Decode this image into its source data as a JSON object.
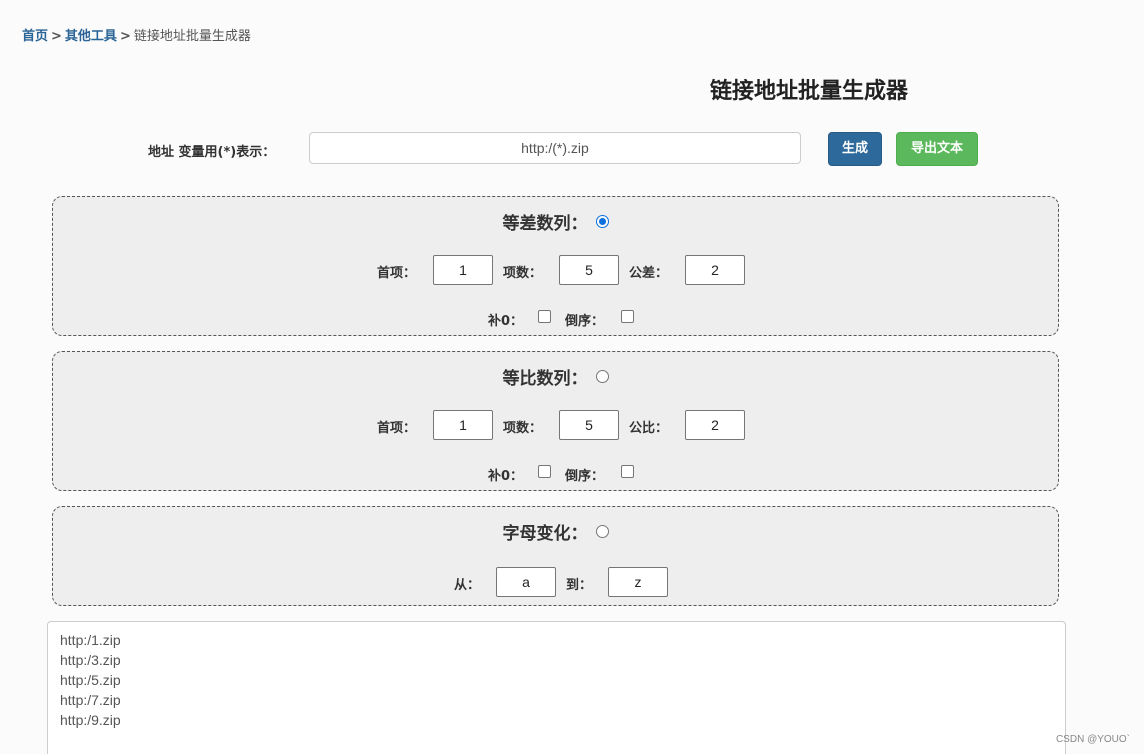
{
  "breadcrumb": {
    "home": "首页",
    "sep1": ">",
    "tools": "其他工具",
    "sep2": ">",
    "current": "链接地址批量生成器"
  },
  "title": "链接地址批量生成器",
  "address": {
    "label": "地址 变量用(*)表示：",
    "value": "http:/(*).zip"
  },
  "buttons": {
    "generate": "生成",
    "export": "导出文本"
  },
  "arithmetic": {
    "heading": "等差数列：",
    "selected": true,
    "first_label": "首项：",
    "first_value": "1",
    "count_label": "项数：",
    "count_value": "5",
    "diff_label": "公差：",
    "diff_value": "2",
    "pad_label": "补0：",
    "pad_checked": false,
    "reverse_label": "倒序：",
    "reverse_checked": false
  },
  "geometric": {
    "heading": "等比数列：",
    "selected": false,
    "first_label": "首项：",
    "first_value": "1",
    "count_label": "项数：",
    "count_value": "5",
    "ratio_label": "公比：",
    "ratio_value": "2",
    "pad_label": "补0：",
    "pad_checked": false,
    "reverse_label": "倒序：",
    "reverse_checked": false
  },
  "letters": {
    "heading": "字母变化：",
    "selected": false,
    "from_label": "从：",
    "from_value": "a",
    "to_label": "到：",
    "to_value": "z"
  },
  "output": {
    "lines": [
      "http:/1.zip",
      "http:/3.zip",
      "http:/5.zip",
      "http:/7.zip",
      "http:/9.zip"
    ]
  },
  "watermark": "CSDN @YOUO`"
}
